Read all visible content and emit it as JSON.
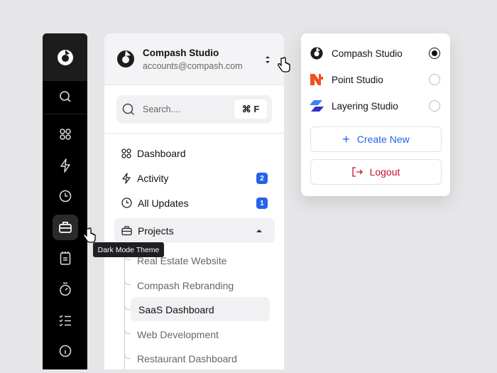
{
  "rail": {
    "items": [
      "search",
      "dashboard",
      "activity",
      "updates",
      "projects",
      "notes",
      "timer",
      "tasks",
      "info"
    ],
    "active": "projects"
  },
  "tooltip": "Dark Mode Theme",
  "account": {
    "name": "Compash Studio",
    "email": "accounts@compash.com"
  },
  "search": {
    "placeholder": "Search....",
    "shortcut": "⌘ F"
  },
  "nav": [
    {
      "label": "Dashboard"
    },
    {
      "label": "Activity",
      "badge": "2"
    },
    {
      "label": "All Updates",
      "badge": "1"
    },
    {
      "label": "Projects"
    }
  ],
  "projects": [
    "Real Estate Website",
    "Compash Rebranding",
    "SaaS Dashboard",
    "Web Development",
    "Restaurant Dashboard"
  ],
  "active_project": "SaaS Dashboard",
  "workspaces": [
    {
      "name": "Compash Studio",
      "selected": true
    },
    {
      "name": "Point Studio",
      "selected": false
    },
    {
      "name": "Layering Studio",
      "selected": false
    }
  ],
  "create_label": "Create New",
  "logout_label": "Logout",
  "colors": {
    "accent": "#2563eb",
    "danger": "#c8102e",
    "point": "#f04e23",
    "layering": "#3b5bfd"
  }
}
